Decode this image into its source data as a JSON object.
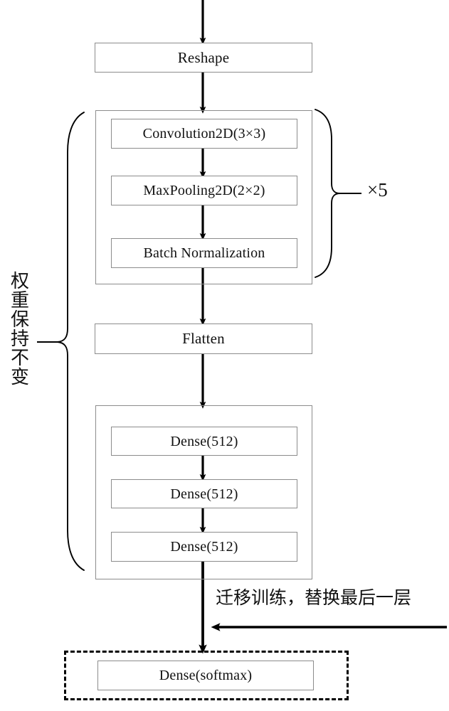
{
  "diagram": {
    "title_text_present": false,
    "background_color": "#ffffff",
    "line_color": "#000000",
    "box_border_color": "#8c8c8c",
    "nodes": {
      "reshape": "Reshape",
      "conv2d": "Convolution2D(3×3)",
      "maxpool2d": "MaxPooling2D(2×2)",
      "batchnorm": "Batch Normalization",
      "flatten": "Flatten",
      "dense1": "Dense(512)",
      "dense2": "Dense(512)",
      "dense3": "Dense(512)",
      "dense_softmax": "Dense(softmax)"
    },
    "annotations": {
      "repeat_label": "×5",
      "frozen_weights_label": "权重保持不变",
      "transfer_label": "迁移训练，替换最后一层"
    }
  }
}
